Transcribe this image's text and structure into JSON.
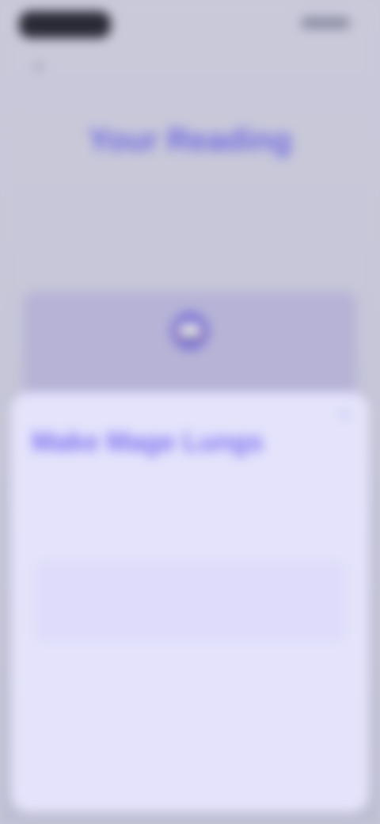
{
  "status_bar": {
    "time": "",
    "icons": [
      "signal-icon",
      "wifi-icon",
      "battery-icon"
    ]
  },
  "nav": {
    "back_glyph": "‹"
  },
  "hero": {
    "title": "Your Reading",
    "subtitle": ""
  },
  "preview": {
    "icon": "book-icon",
    "label": ""
  },
  "sheet": {
    "close_glyph": "×",
    "title": "Make Mage Lungs",
    "subtitle": "",
    "heading": "",
    "input_placeholder": "",
    "options": [
      {
        "label": ""
      },
      {
        "label": ""
      },
      {
        "label": ""
      },
      {
        "label": ""
      },
      {
        "label": ""
      }
    ]
  },
  "colors": {
    "accent": "#7a6ff1",
    "sheet_background": "#e4e3fb",
    "screen_background": "#c8c8d8"
  }
}
